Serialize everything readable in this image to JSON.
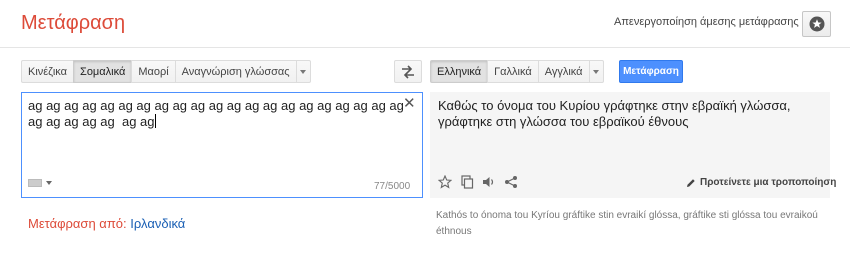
{
  "header": {
    "app_title": "Μετάφραση",
    "instant_toggle": "Απενεργοποίηση άμεσης μετάφρασης",
    "star_icon": "star-icon"
  },
  "source_langs": [
    "Κινέζικα",
    "Σομαλικά",
    "Μαορί",
    "Αναγνώριση γλώσσας"
  ],
  "source_selected_index": 1,
  "target_langs": [
    "Ελληνικά",
    "Γαλλικά",
    "Αγγλικά"
  ],
  "target_selected_index": 0,
  "translate_button": "Μετάφραση",
  "source": {
    "text": "ag ag ag ag ag ag ag ag ag ag ag ag ag ag ag ag ag ag ag ag ag ag ag ag ag ag  ag ag",
    "char_count": "77/5000"
  },
  "target": {
    "text": "Καθώς το όνομα του Κυρίου γράφτηκε στην εβραϊκή γλώσσα, γράφτηκε στη γλώσσα του εβραϊκού έθνους",
    "suggest_label": "Προτείνετε μια τροποποίηση",
    "transliteration": "Kathós to ónoma tou Kyríou gráftike stin evraikí glóssa, gráftike sti glóssa tou evraikoú éthnous"
  },
  "detected": {
    "label": "Μετάφραση από:",
    "language": "Ιρλανδικά"
  },
  "colors": {
    "accent": "#dd4b39",
    "button_blue": "#4d90fe",
    "link": "#1a5fb4"
  }
}
